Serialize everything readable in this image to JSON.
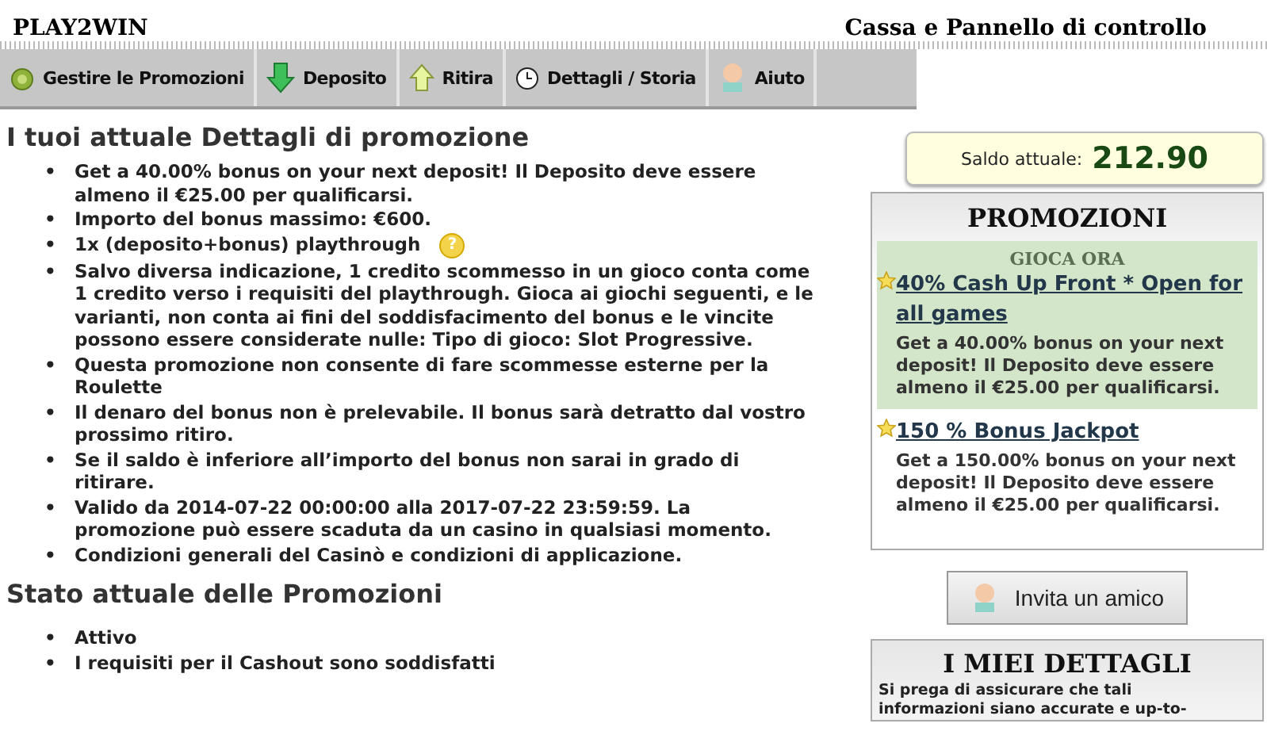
{
  "header": {
    "logo": "PLAY2WIN",
    "title": "Cassa e Pannello di controllo"
  },
  "nav": [
    {
      "label": "Gestire le Promozioni",
      "kind": "chip"
    },
    {
      "label": "Deposito",
      "kind": "down"
    },
    {
      "label": "Ritira",
      "kind": "up"
    },
    {
      "label": "Dettagli / Storia",
      "kind": "clock"
    },
    {
      "label": "Aiuto",
      "kind": "person"
    }
  ],
  "details": {
    "heading": "I tuoi attuale Dettagli di promozione",
    "items": [
      {
        "bullet": "•",
        "text": "Get a 40.00% bonus on your next deposit! Il Deposito deve essere almeno il €25.00 per qualificarsi."
      },
      {
        "bullet": "•",
        "text": "Importo del bonus massimo: €600."
      },
      {
        "bullet": "•",
        "text": "1x (deposito+bonus) playthrough",
        "help_icon": "?"
      },
      {
        "bullet": "•",
        "text": "Salvo diversa indicazione, 1 credito scommesso in un gioco conta come 1 credito verso i requisiti del playthrough. Gioca ai giochi seguenti, e le varianti, non conta ai fini del soddisfacimento del bonus e le vincite possono essere considerate nulle: Tipo di gioco: Slot Progressive."
      },
      {
        "bullet": "•",
        "text": "Questa promozione non consente di fare scommesse esterne per la Roulette"
      },
      {
        "bullet": "•",
        "text": "Il denaro del bonus non è prelevabile. Il bonus sarà detratto dal vostro prossimo ritiro."
      },
      {
        "bullet": "•",
        "text": "Se il saldo è inferiore all’importo del bonus non sarai in grado di ritirare."
      },
      {
        "bullet": "•",
        "text": "Valido da 2014-07-22 00:00:00 alla 2017-07-22 23:59:59. La promozione può essere scaduta da un casino in qualsiasi momento."
      },
      {
        "bullet": "•",
        "text": "Condizioni generali del Casinò e condizioni di applicazione."
      }
    ]
  },
  "status": {
    "heading": "Stato attuale delle Promozioni",
    "items": [
      {
        "bullet": "•",
        "text": "Attivo"
      },
      {
        "bullet": "•",
        "text": "I requisiti per il Cashout sono soddisfatti"
      }
    ]
  },
  "balance": {
    "label": "Saldo attuale:",
    "amount": "212.90"
  },
  "promotions": {
    "heading": "PROMOZIONI",
    "items": [
      {
        "tag": "GIOCA ORA",
        "title": "40% Cash Up Front * Open for all games",
        "text": "Get a 40.00% bonus on your next deposit! Il Deposito deve essere almeno il €25.00 per qualificarsi.",
        "selected": true
      },
      {
        "title": "150 % Bonus Jackpot",
        "text": "Get a 150.00% bonus on your next deposit! Il Deposito deve essere almeno il €25.00 per qualificarsi.",
        "selected": false
      }
    ]
  },
  "invite_button": "Invita un amico",
  "my_details": {
    "heading": "I MIEI DETTAGLI",
    "text": "Si prega di assicurare che tali",
    "text_cut": "informazioni siano accurate e up-to-"
  }
}
